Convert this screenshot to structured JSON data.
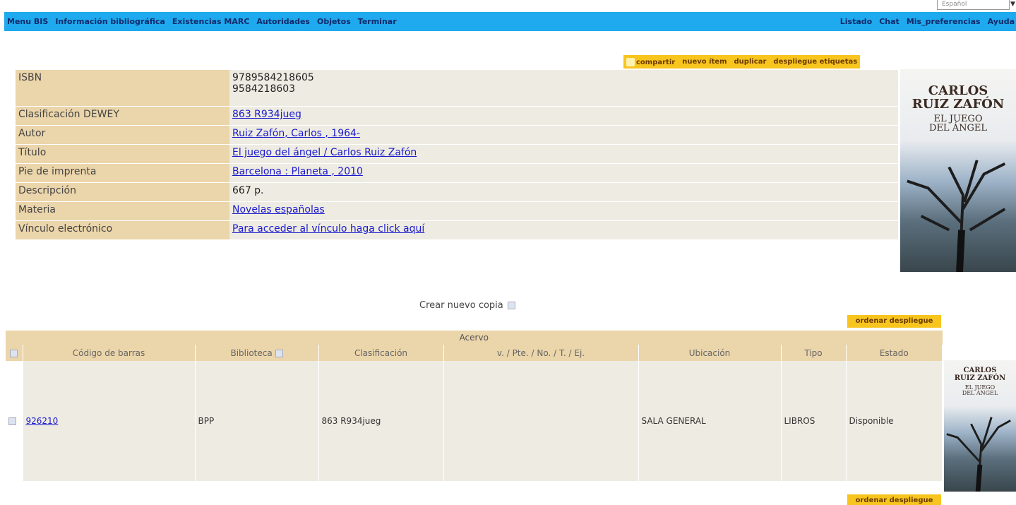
{
  "topbar": {
    "select_value": "Español"
  },
  "menu": {
    "left": [
      "Menu BIS",
      "Información bibliográfica",
      "Existencias MARC",
      "Autoridades",
      "Objetos",
      "Terminar"
    ],
    "right": [
      "Listado",
      "Chat",
      "Mis_preferencias",
      "Ayuda"
    ]
  },
  "actions": {
    "share": "compartir",
    "new_item": "nuevo ítem",
    "duplicate": "duplicar",
    "labels": "despliegue etiquetas"
  },
  "record": {
    "isbn_label": "ISBN",
    "isbn_values": [
      "9789584218605",
      "9584218603"
    ],
    "dewey_label": "Clasificación DEWEY",
    "dewey": "863 R934jueg",
    "author_label": "Autor",
    "author": "Ruiz Zafón, Carlos , 1964-",
    "title_label": "Título",
    "title": "El juego del ángel / Carlos Ruiz Zafón",
    "imprint_label": "Pie de imprenta",
    "imprint": "Barcelona : Planeta , 2010",
    "description_label": "Descripción",
    "description": "667 p.",
    "subject_label": "Materia",
    "subject": "Novelas españolas",
    "link_label": "Vínculo electrónico",
    "link": "Para acceder al vínculo haga click aquí"
  },
  "cover": {
    "author_line1": "CARLOS",
    "author_line2": "RUIZ ZAFÓN",
    "title_line1": "EL JUEGO",
    "title_line2": "DEL ÁNGEL"
  },
  "copies": {
    "new_copy_label": "Crear nuevo copia",
    "order_label": "ordenar despliegue",
    "group_title": "Acervo",
    "columns": [
      "Código de barras",
      "Biblioteca",
      "Clasificación",
      "v. / Pte. / No. / T. / Ej.",
      "Ubicación",
      "Tipo",
      "Estado"
    ],
    "rows": [
      {
        "barcode": "926210",
        "library": "BPP",
        "classification": "863 R934jueg",
        "volume": "",
        "location": "SALA GENERAL",
        "type": "LIBROS",
        "status": "Disponible"
      }
    ]
  },
  "colors": {
    "menu_bg": "#1fa9ee",
    "label_bg": "#ebd5aa",
    "value_bg": "#eeebe3",
    "button_bg": "#f7c51e",
    "status_available": "#2d9b2d"
  }
}
